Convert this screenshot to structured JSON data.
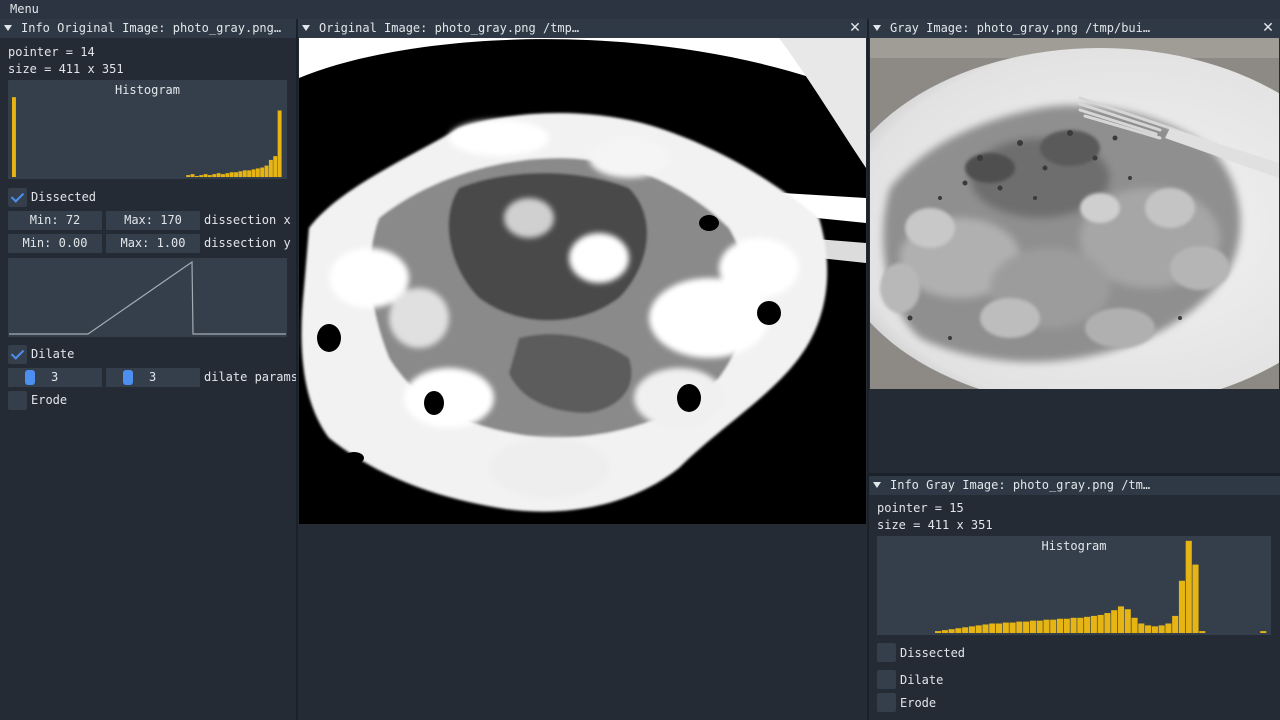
{
  "menubar": {
    "menu_label": "Menu"
  },
  "info_original": {
    "title": "Info Original Image: photo_gray.png…",
    "pointer": "pointer = 14",
    "size": "size = 411 x 351",
    "histogram_title": "Histogram",
    "histogram_color": "#e6b514",
    "histogram_values": [
      0.84,
      0,
      0,
      0,
      0,
      0,
      0,
      0,
      0,
      0,
      0,
      0,
      0,
      0,
      0,
      0,
      0,
      0,
      0,
      0,
      0,
      0,
      0,
      0,
      0,
      0,
      0,
      0,
      0,
      0,
      0,
      0,
      0,
      0,
      0,
      0,
      0,
      0,
      0,
      0,
      0.02,
      0.03,
      0.01,
      0.02,
      0.03,
      0.02,
      0.03,
      0.04,
      0.03,
      0.04,
      0.05,
      0.05,
      0.06,
      0.07,
      0.07,
      0.08,
      0.09,
      0.1,
      0.12,
      0.18,
      0.22,
      0.7
    ],
    "dissected_label": "Dissected",
    "dissected_checked": true,
    "min_x": "Min: 72",
    "max_x": "Max: 170",
    "dissection_x_label": "dissection x",
    "min_y": "Min: 0.00",
    "max_y": "Max: 1.00",
    "dissection_y_label": "dissection y",
    "curve_color": "#a5abb2",
    "dilate_label": "Dilate",
    "dilate_checked": true,
    "dilate_param_1": "3",
    "dilate_param_2": "3",
    "dilate_params_label": "dilate params",
    "erode_label": "Erode",
    "erode_checked": false
  },
  "original_image": {
    "title": "Original Image: photo_gray.png /tmp…",
    "close_glyph": "✕"
  },
  "gray_image": {
    "title": "Gray Image: photo_gray.png /tmp/bui…",
    "close_glyph": "✕"
  },
  "info_gray": {
    "title": "Info Gray Image: photo_gray.png /tm…",
    "pointer": "pointer = 15",
    "size": "size = 411 x 351",
    "histogram_title": "Histogram",
    "histogram_color": "#e6b514",
    "histogram_values": [
      0.02,
      0.03,
      0.04,
      0.05,
      0.06,
      0.07,
      0.08,
      0.09,
      0.1,
      0.1,
      0.11,
      0.11,
      0.12,
      0.12,
      0.13,
      0.13,
      0.14,
      0.14,
      0.15,
      0.15,
      0.16,
      0.16,
      0.17,
      0.18,
      0.19,
      0.21,
      0.24,
      0.28,
      0.25,
      0.16,
      0.1,
      0.08,
      0.07,
      0.08,
      0.1,
      0.18,
      0.55,
      0.97,
      0.72,
      0.02,
      0,
      0,
      0,
      0,
      0,
      0,
      0,
      0,
      0.02
    ],
    "dissected_label": "Dissected",
    "dissected_checked": false,
    "dilate_label": "Dilate",
    "dilate_checked": false,
    "erode_label": "Erode",
    "erode_checked": false
  }
}
